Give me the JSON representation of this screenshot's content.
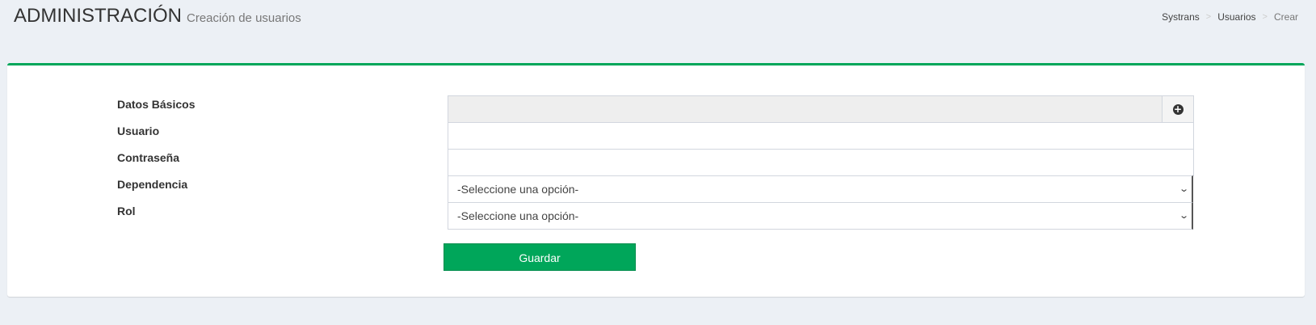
{
  "header": {
    "title": "ADMINISTRACIÓN",
    "subtitle": "Creación de usuarios"
  },
  "breadcrumb": {
    "items": [
      "Systrans",
      "Usuarios",
      "Crear"
    ],
    "separator": ">"
  },
  "form": {
    "basic_data_label": "Datos Básicos",
    "basic_data_add_icon": "plus-circle-icon",
    "user_label": "Usuario",
    "user_value": "",
    "password_label": "Contraseña",
    "password_value": "",
    "dependency_label": "Dependencia",
    "dependency_selected": "-Seleccione una opción-",
    "role_label": "Rol",
    "role_selected": "-Seleccione una opción-",
    "save_label": "Guardar"
  },
  "colors": {
    "background": "#ecf0f5",
    "accent": "#00a65a",
    "panel": "#ffffff"
  }
}
